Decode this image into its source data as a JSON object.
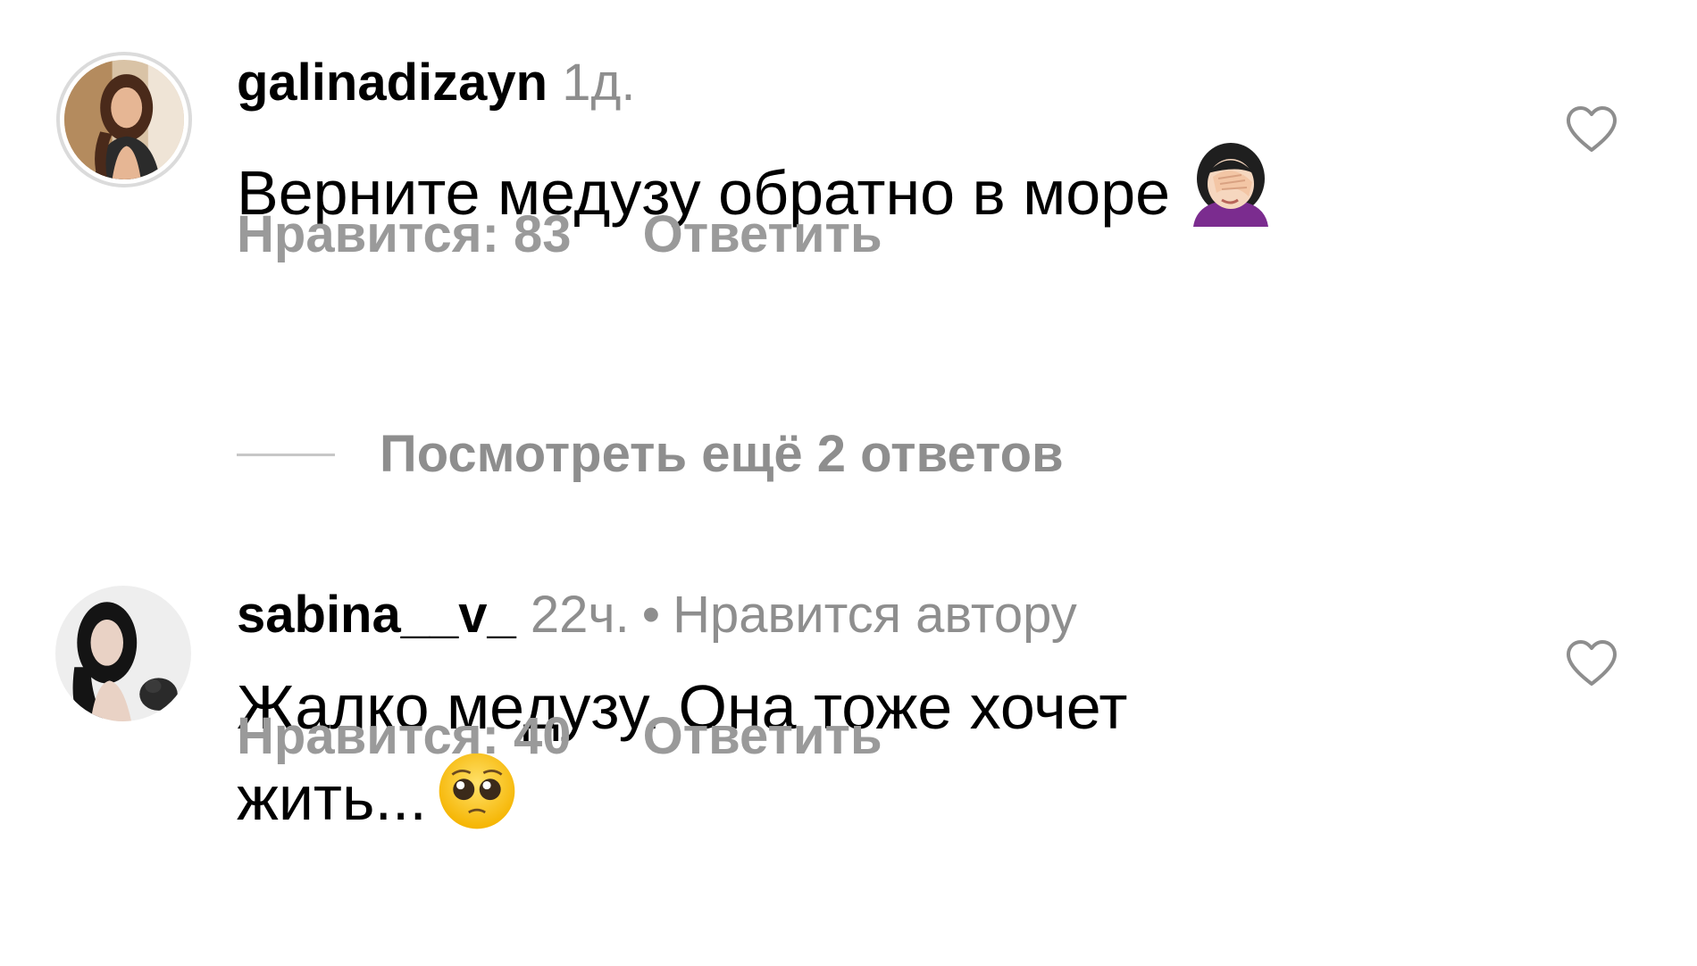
{
  "comments": [
    {
      "username": "galinadizayn",
      "time": "1д.",
      "text": "Верните медузу обратно в море",
      "emoji": "face-palm-woman-emoji",
      "likes_label": "Нравится: 83",
      "reply_label": "Ответить"
    },
    {
      "username": "sabina__v_",
      "time": "22ч.",
      "separator": "•",
      "author_liked": "Нравится автору",
      "text_line1": "Жалко медузу. Она тоже хочет",
      "text_line2": "жить...",
      "emoji": "pleading-face-emoji",
      "likes_label": "Нравится: 40",
      "reply_label": "Ответить"
    }
  ],
  "view_replies_label": "Посмотреть ещё 2 ответов",
  "icons": {
    "like": "heart-outline-icon"
  },
  "colors": {
    "text": "#000000",
    "muted": "#8e8e8e",
    "action": "#9a9a9a",
    "divider": "#c7c7c7",
    "avatar_ring": "#dbdbdb"
  }
}
